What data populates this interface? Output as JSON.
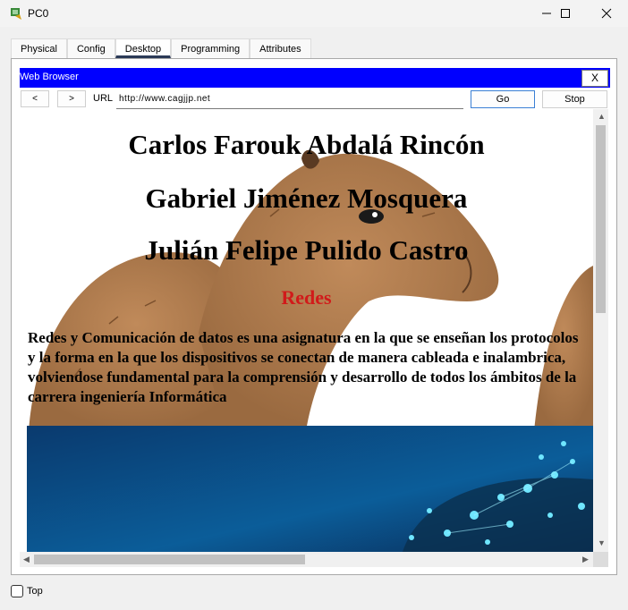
{
  "window": {
    "title": "PC0"
  },
  "tabs": [
    "Physical",
    "Config",
    "Desktop",
    "Programming",
    "Attributes"
  ],
  "browser": {
    "title": "Web Browser",
    "close_label": "X",
    "back_label": "<",
    "forward_label": ">",
    "url_label": "URL",
    "url_value": "http://www.cagjjp.net",
    "go_label": "Go",
    "stop_label": "Stop"
  },
  "page": {
    "names": [
      "Carlos Farouk Abdalá Rincón",
      "Gabriel Jiménez Mosquera",
      "Julián Felipe Pulido Castro"
    ],
    "subtitle": "Redes",
    "paragraph": "Redes y Comunicación de datos es una asignatura en la que se enseñan los protocolos y la forma en la que los dispositivos se conectan de manera cableada e inalambrica, volviendose fundamental para la comprensión y desarrollo de todos los ámbitos de la carrera ingeniería Informática"
  },
  "footer": {
    "top_label": "Top"
  },
  "colors": {
    "browser_bar": "#0000ff",
    "subtitle": "#d11a1a",
    "background_animal": "#b07a4e",
    "photo": "#0a4f8a"
  }
}
